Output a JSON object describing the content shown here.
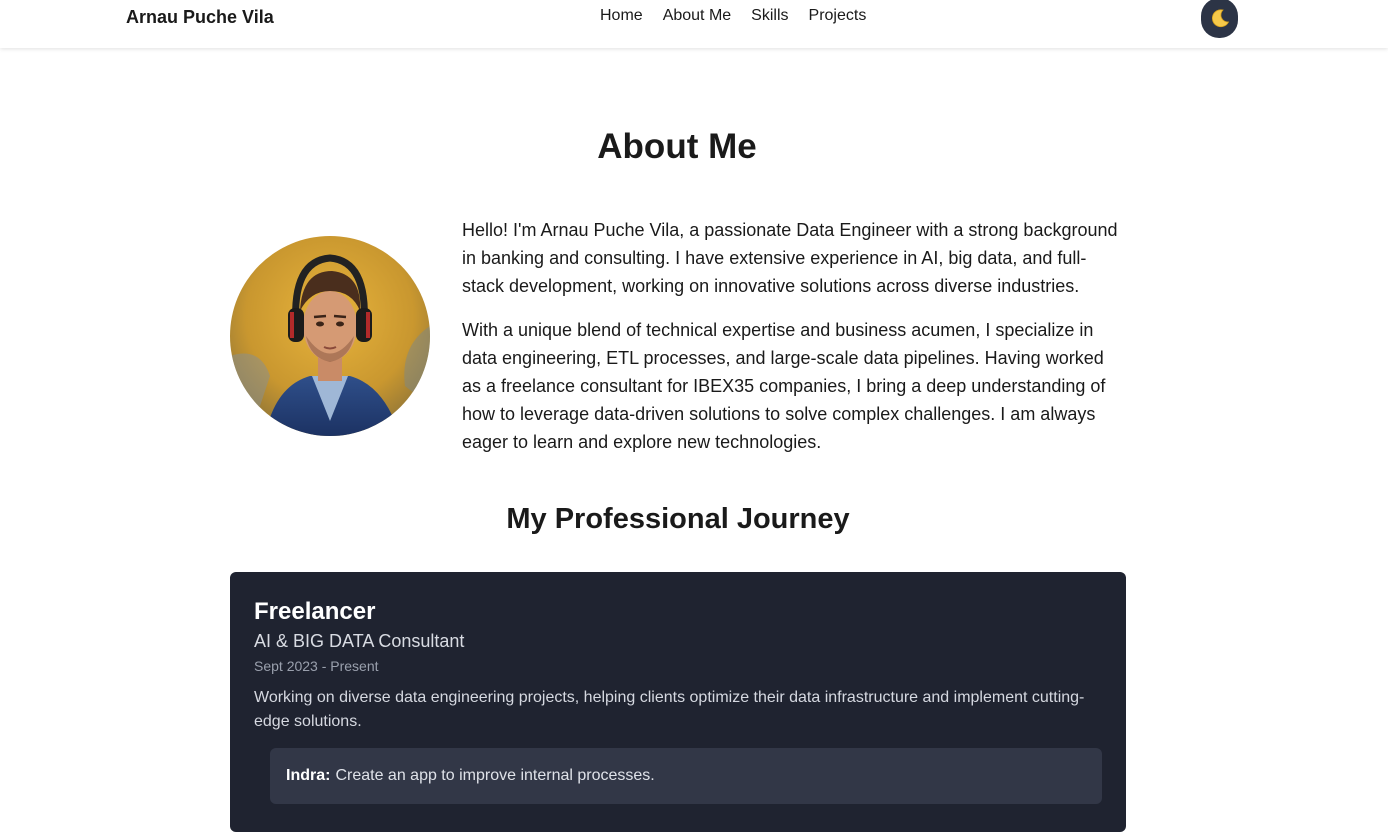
{
  "header": {
    "brand": "Arnau Puche Vila",
    "nav": [
      "Home",
      "About Me",
      "Skills",
      "Projects"
    ],
    "theme_toggle_icon": "moon-icon"
  },
  "about": {
    "title": "About Me",
    "avatar_icon": "profile-photo",
    "paragraphs": [
      "Hello! I'm Arnau Puche Vila, a passionate Data Engineer with a strong background in banking and consulting. I have extensive experience in AI, big data, and full-stack development, working on innovative solutions across diverse industries.",
      "With a unique blend of technical expertise and business acumen, I specialize in data engineering, ETL processes, and large-scale data pipelines. Having worked as a freelance consultant for IBEX35 companies, I bring a deep understanding of how to leverage data-driven solutions to solve complex challenges. I am always eager to learn and explore new technologies."
    ]
  },
  "journey": {
    "title": "My Professional Journey",
    "entries": [
      {
        "company": "Freelancer",
        "role": "AI & BIG DATA Consultant",
        "dates": "Sept 2023 - Present",
        "description": "Working on diverse data engineering projects, helping clients optimize their data infrastructure and implement cutting-edge solutions.",
        "projects": [
          {
            "client": "Indra:",
            "text": "Create an app to improve internal processes."
          }
        ]
      }
    ]
  },
  "colors": {
    "card_bg": "#1f2330",
    "project_bg": "#323747",
    "toggle_bg": "#2c3446"
  }
}
